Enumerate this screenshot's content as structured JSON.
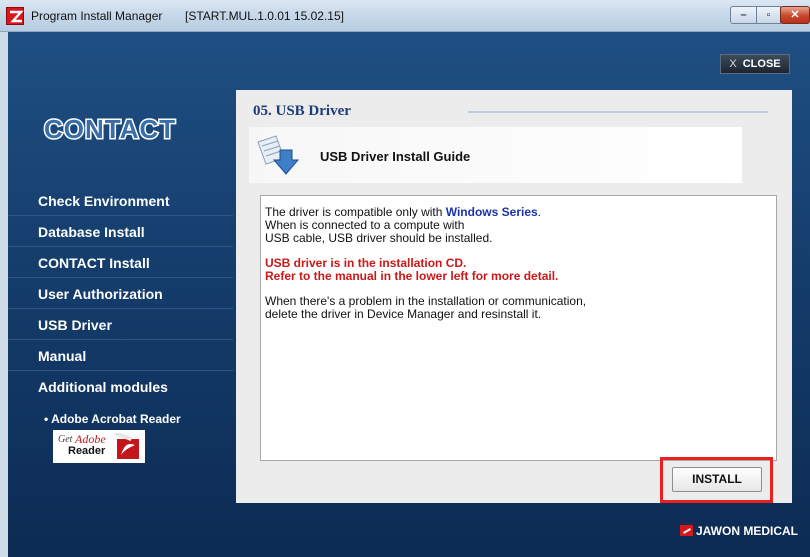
{
  "window": {
    "title": "Program Install Manager",
    "version": "[START.MUL.1.0.01 15.02.15]"
  },
  "header": {
    "close_label": "CLOSE",
    "close_glyph": "X"
  },
  "logo": {
    "text": "CONTACT"
  },
  "sidebar": {
    "items": [
      {
        "label": "Check Environment"
      },
      {
        "label": "Database Install"
      },
      {
        "label": "CONTACT Install"
      },
      {
        "label": "User Authorization"
      },
      {
        "label": "USB Driver"
      },
      {
        "label": "Manual"
      },
      {
        "label": "Additional modules"
      }
    ],
    "sub_item": "• Adobe Acrobat Reader",
    "adobe_badge": {
      "get": "Get",
      "brand": "Adobe",
      "product": "Reader"
    }
  },
  "panel": {
    "title": "05. USB Driver",
    "guide": "USB Driver Install Guide",
    "text": {
      "line1_prefix": "The driver is compatible only with ",
      "line1_highlight": "Windows Series",
      "line1_suffix": ".",
      "line2": "When  is connected to a compute with",
      "line3": "USB cable, USB driver should be installed.",
      "red1": "USB driver is in the installation CD.",
      "red2": "Refer to the manual in the lower left for more detail.",
      "line4": "When there's a problem in the installation or communication,",
      "line5": "delete the driver in Device Manager and resinstall it."
    },
    "install_label": "INSTALL"
  },
  "footer": {
    "brand": "JAWON MEDICAL"
  },
  "colors": {
    "accent_red": "#e8201f",
    "nav_blue": "#153d6c",
    "title_blue": "#1d3c78"
  }
}
